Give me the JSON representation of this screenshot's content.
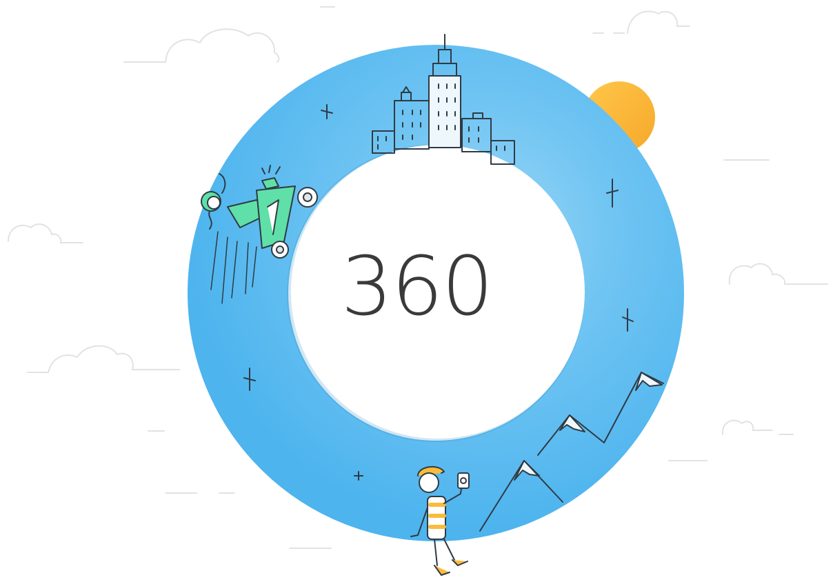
{
  "hero": {
    "label": "360",
    "ring_color": "#55b9ef",
    "ring_highlight_color": "#8fd2f6",
    "sun_color": "#fbbb3a",
    "scooter_color": "#5fe0a8",
    "text_color": "#3a3a3a"
  },
  "illustrations": {
    "icons": [
      "cloud-icon",
      "sun-icon",
      "city-skyline-icon",
      "scooter-rider-icon",
      "mountains-icon",
      "photographer-person-icon",
      "sparkle-icon"
    ]
  }
}
